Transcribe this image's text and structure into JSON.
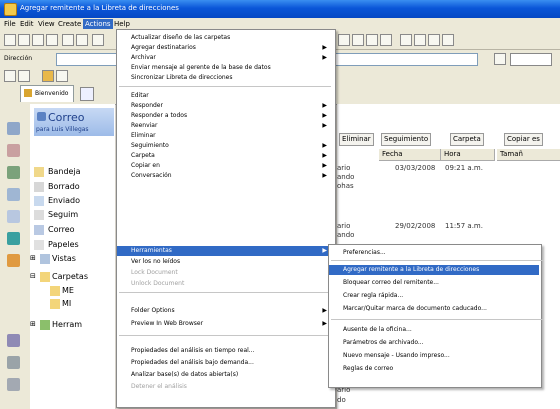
{
  "window": {
    "title": "Agregar remitente a la Libreta de direcciones"
  },
  "menubar": {
    "items": [
      "File",
      "Edit",
      "View",
      "Create",
      "Actions",
      "Help"
    ]
  },
  "addressbar": {
    "label": "Dirección"
  },
  "tab": {
    "label": "Bienvenido"
  },
  "folderpane": {
    "title": "Correo",
    "subtitle": "para Luis Villegas",
    "items": [
      "Bandeja",
      "Borrado",
      "Enviado",
      "Seguim",
      "Correo",
      "Papeles",
      "Vistas",
      "Carpetas",
      "ME",
      "MI",
      "Herram"
    ]
  },
  "rightpane": {
    "buttons": [
      "Eliminar",
      "Seguimiento",
      "Carpeta",
      "Copiar es"
    ],
    "headers": [
      "Fecha",
      "Hora",
      "Tamañ"
    ],
    "rows": [
      {
        "date": "03/03/2008",
        "time": "09:21 a.m."
      },
      {
        "date": "29/02/2008",
        "time": "11:57 a.m."
      }
    ],
    "bits": [
      "ario",
      "ando",
      "ohas",
      "ario",
      "ando"
    ],
    "bottom": [
      "ario",
      "do"
    ]
  },
  "actions_menu": {
    "items": [
      {
        "label": "Actualizar diseño de las carpetas",
        "arrow": false,
        "disabled": false
      },
      {
        "label": "Agregar destinatarios",
        "arrow": true,
        "disabled": false
      },
      {
        "label": "Archivar",
        "arrow": true,
        "disabled": false
      },
      {
        "label": "Enviar mensaje al gerente de la base de datos",
        "arrow": false,
        "disabled": false
      },
      {
        "label": "Sincronizar Libreta de direcciones",
        "arrow": false,
        "disabled": false
      },
      {
        "label": "Editar",
        "arrow": false,
        "disabled": false
      },
      {
        "label": "Responder",
        "arrow": true,
        "disabled": false
      },
      {
        "label": "Responder a todos",
        "arrow": true,
        "disabled": false
      },
      {
        "label": "Reenviar",
        "arrow": true,
        "disabled": false
      },
      {
        "label": "Eliminar",
        "arrow": false,
        "disabled": false
      },
      {
        "label": "Seguimiento",
        "arrow": true,
        "disabled": false
      },
      {
        "label": "Carpeta",
        "arrow": true,
        "disabled": false
      },
      {
        "label": "Copiar en",
        "arrow": true,
        "disabled": false
      },
      {
        "label": "Conversación",
        "arrow": true,
        "disabled": false
      },
      {
        "label": "Herramientas",
        "arrow": true,
        "disabled": false,
        "selected": true
      },
      {
        "label": "Ver los no leídos",
        "arrow": false,
        "disabled": false
      },
      {
        "label": "Lock Document",
        "arrow": false,
        "disabled": true
      },
      {
        "label": "Unlock Document",
        "arrow": false,
        "disabled": true
      },
      {
        "label": "Folder Options",
        "arrow": true,
        "disabled": false
      },
      {
        "label": "Preview In Web Browser",
        "arrow": true,
        "disabled": false
      },
      {
        "label": "Propiedades del análisis en tiempo real...",
        "arrow": false,
        "disabled": false
      },
      {
        "label": "Propiedades del análisis bajo demanda...",
        "arrow": false,
        "disabled": false
      },
      {
        "label": "Analizar base(s) de datos abierta(s)",
        "arrow": false,
        "disabled": false
      },
      {
        "label": "Detener el análisis",
        "arrow": false,
        "disabled": true
      }
    ]
  },
  "tools_submenu": {
    "items": [
      "Preferencias...",
      "Agregar remitente a la Libreta de direcciones",
      "Bloquear correo del remitente...",
      "Crear regla rápida...",
      "Marcar/Quitar marca de documento caducado...",
      "Ausente de la oficina...",
      "Parámetros de archivado...",
      "Nuevo mensaje - Usando impreso...",
      "Reglas de correo"
    ],
    "selected_index": 1
  }
}
